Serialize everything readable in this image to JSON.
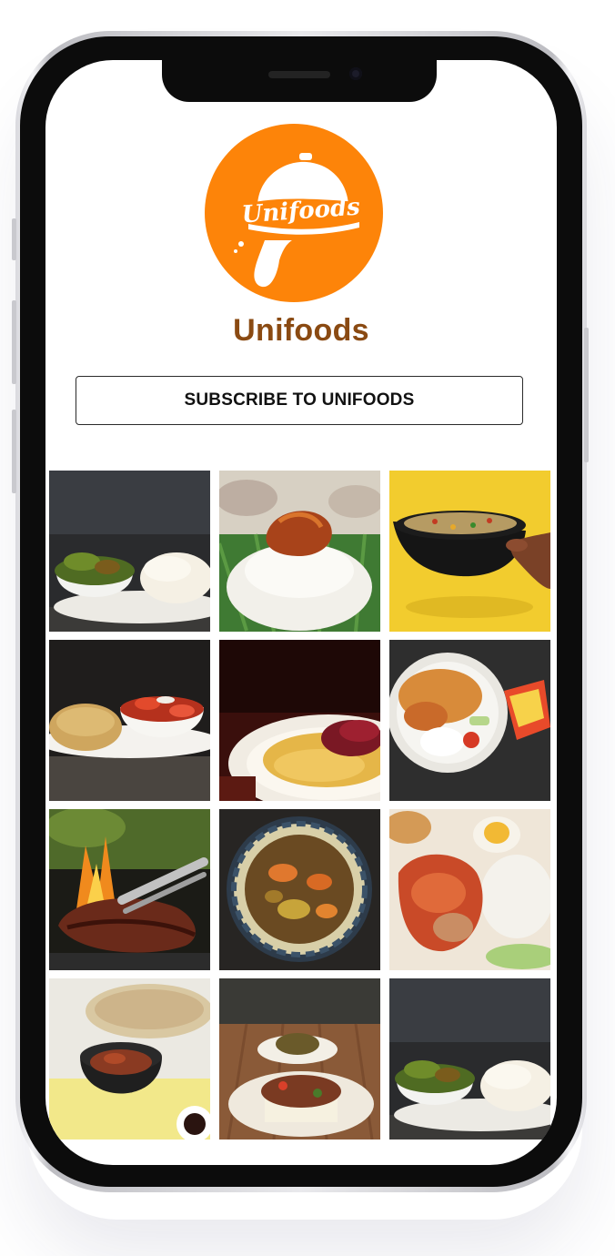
{
  "brand": {
    "logo_text": "Unifoods",
    "name": "Unifoods",
    "accent_color": "#fd8409",
    "name_color": "#8a4a12"
  },
  "subscribe": {
    "label": "SUBSCRIBE TO UNIFOODS"
  },
  "gallery": {
    "photos": [
      {
        "subject": "vegetable soup with pounded yam"
      },
      {
        "subject": "white rice with stew and meat"
      },
      {
        "subject": "fried rice bowl held on yellow background"
      },
      {
        "subject": "fried rice with tomato salad"
      },
      {
        "subject": "jollof rice with berries"
      },
      {
        "subject": "jollof rice with white rice and noodle pack"
      },
      {
        "subject": "grilled steak on barbecue"
      },
      {
        "subject": "vegetable stew in patterned bowl"
      },
      {
        "subject": "rice with chicken and boiled egg"
      },
      {
        "subject": "rice bowl with beef and pancake"
      },
      {
        "subject": "plates on dining table"
      },
      {
        "subject": "vegetable soup with pounded yam"
      }
    ]
  }
}
